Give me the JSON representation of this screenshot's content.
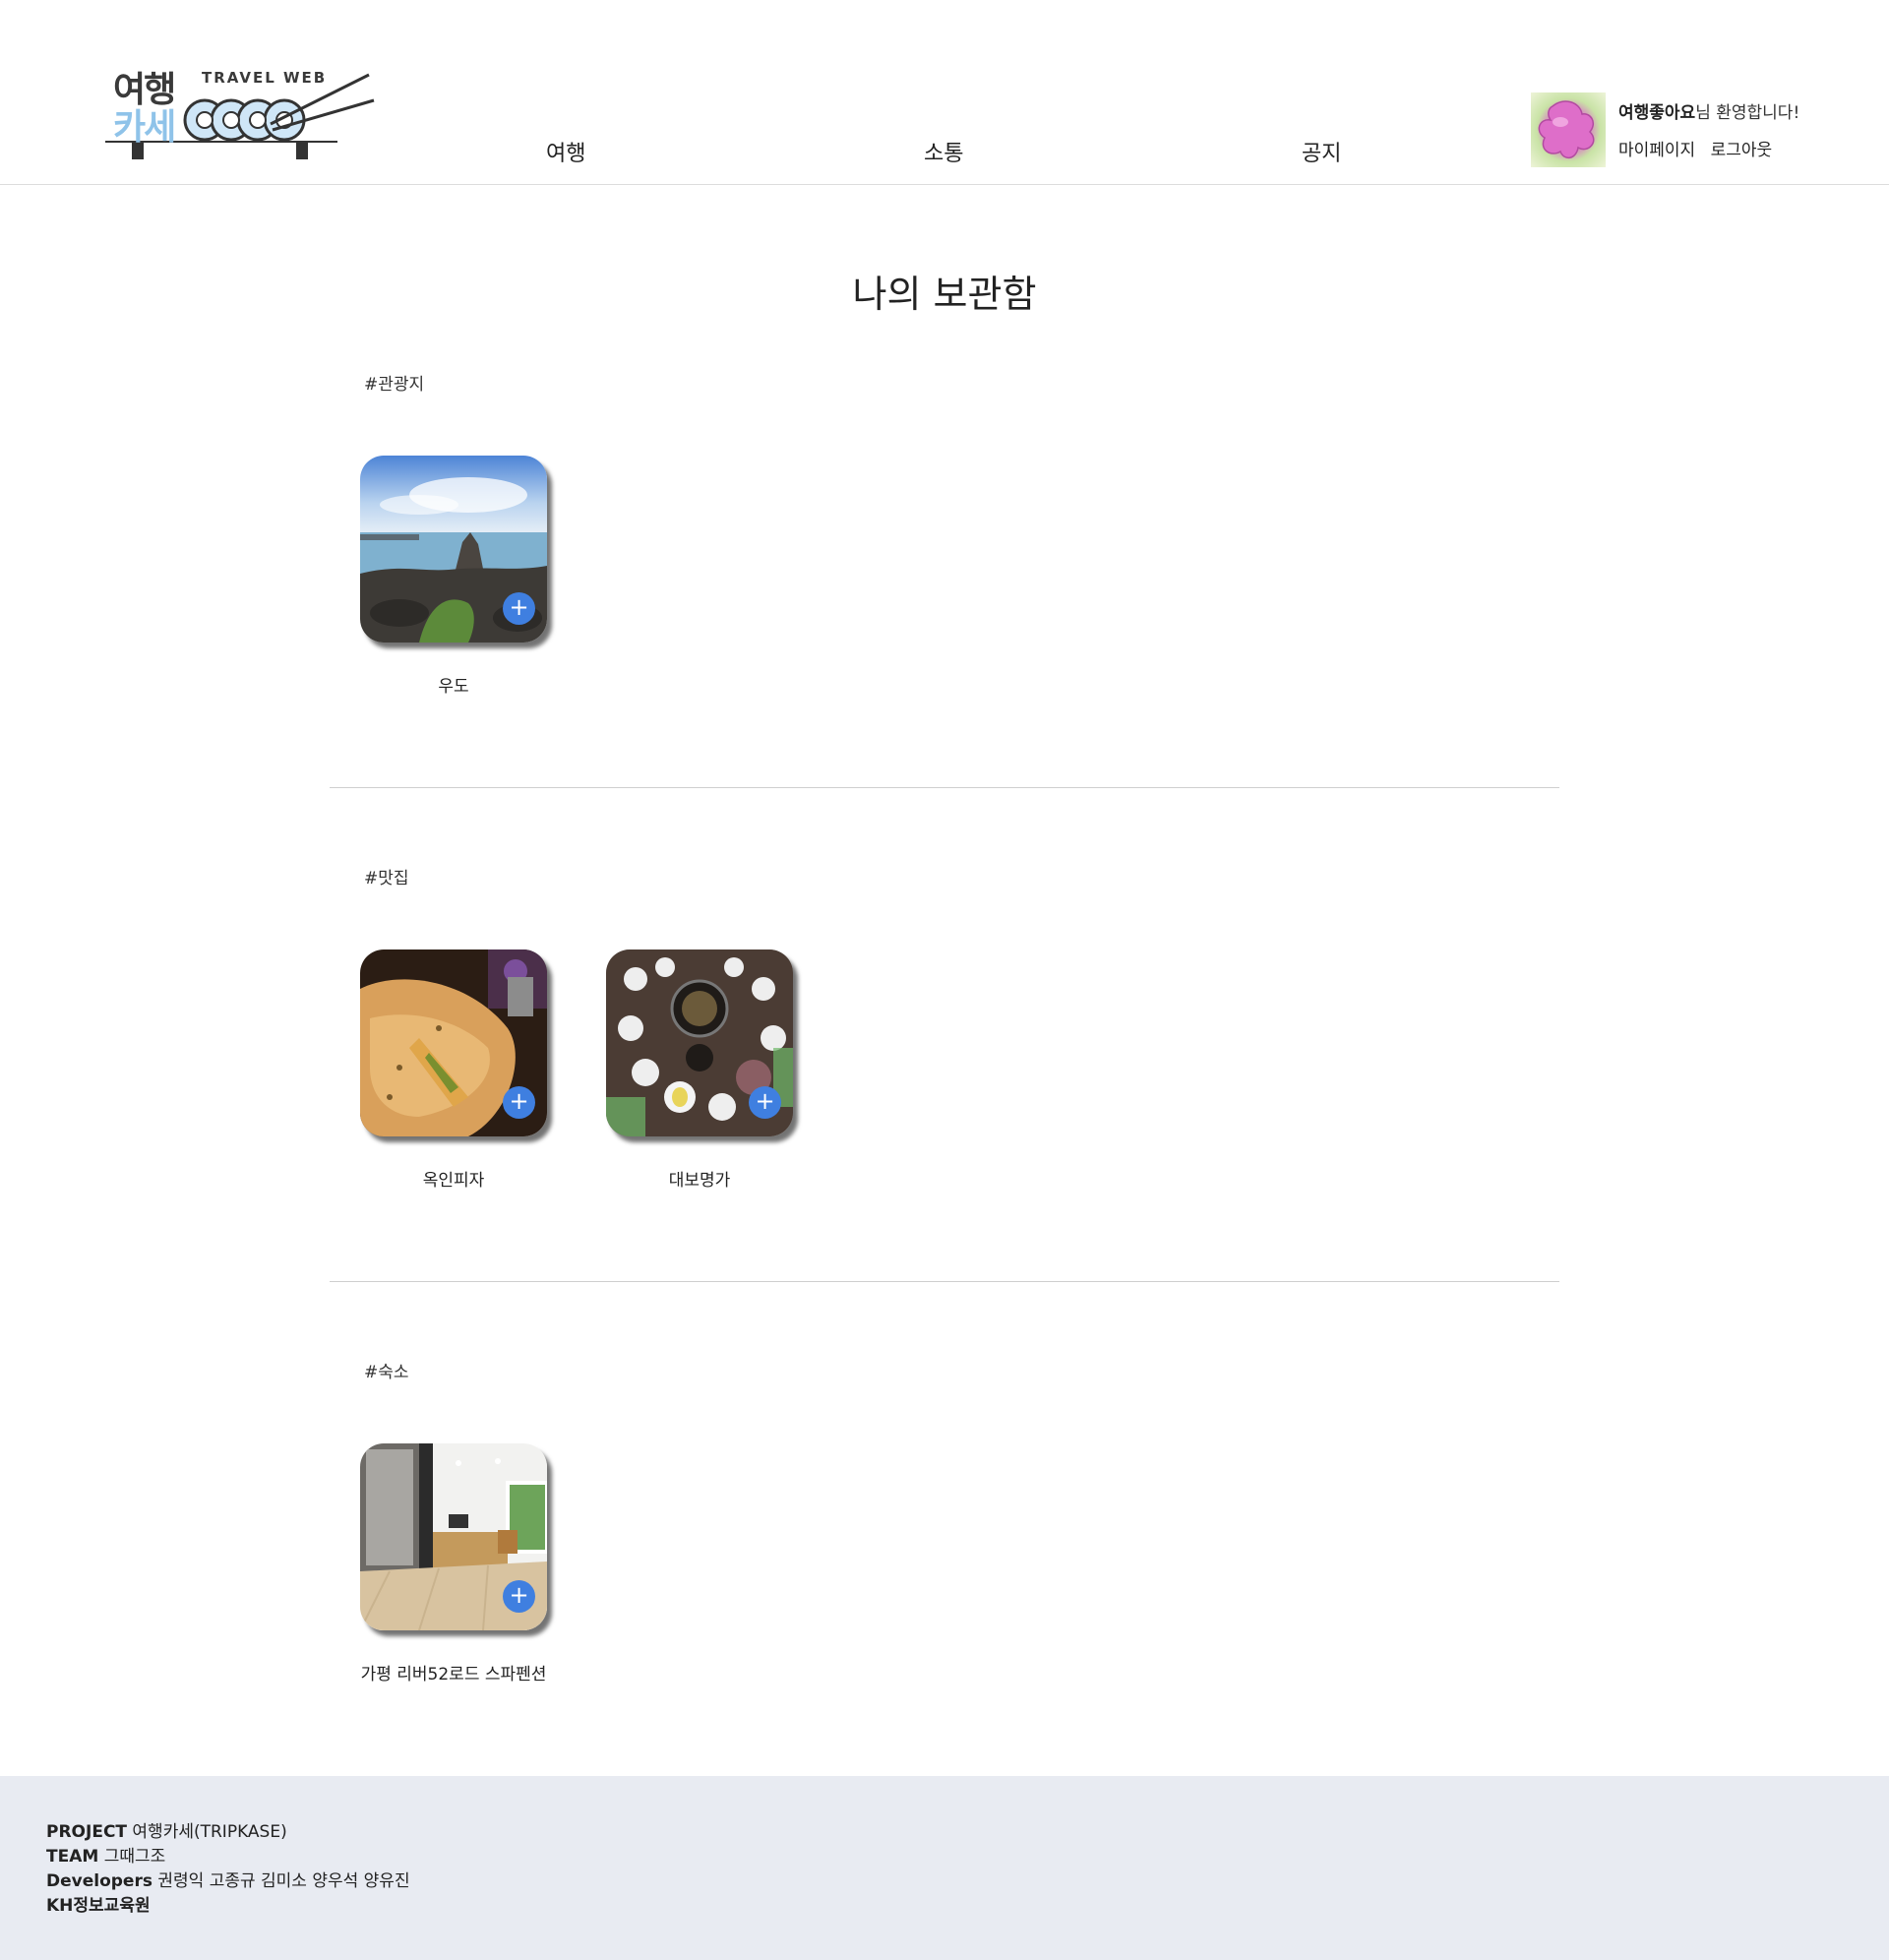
{
  "header": {
    "logo": {
      "kr_top": "여행",
      "kr_bottom": "카세",
      "en": "TRAVEL WEB"
    },
    "nav": [
      "여행",
      "소통",
      "공지"
    ],
    "user": {
      "nickname": "여행좋아요",
      "welcome_suffix": "님 환영합니다!",
      "mypage": "마이페이지",
      "logout": "로그아웃"
    }
  },
  "main": {
    "title": "나의 보관함",
    "sections": [
      {
        "tag": "#관광지",
        "items": [
          {
            "name": "우도",
            "action": "+"
          }
        ]
      },
      {
        "tag": "#맛집",
        "items": [
          {
            "name": "옥인피자",
            "action": "+"
          },
          {
            "name": "대보명가",
            "action": "+"
          }
        ]
      },
      {
        "tag": "#숙소",
        "items": [
          {
            "name": "가평 리버52로드 스파펜션",
            "action": "+"
          }
        ]
      }
    ]
  },
  "footer": {
    "project_label": "PROJECT",
    "project_value": " 여행카세(TRIPKASE)",
    "team_label": "TEAM",
    "team_value": " 그때그조",
    "dev_label": "Developers",
    "dev_value": " 권령익 고종규 김미소 양우석 양유진",
    "org": "KH정보교육원"
  },
  "colors": {
    "accent_plus": "#3f7fe0",
    "logo_blue": "#8fc3e9",
    "footer_bg": "#e8ebf2"
  }
}
